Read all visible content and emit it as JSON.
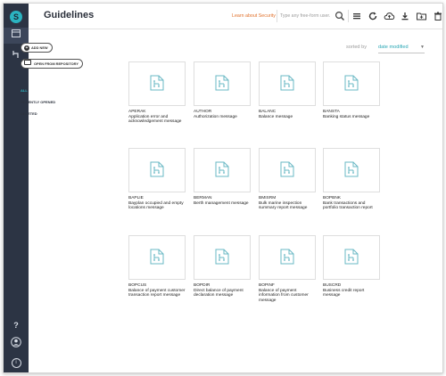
{
  "app": {
    "logo_letter": "S"
  },
  "header": {
    "title": "Guidelines",
    "learn_link": "Learn about Security",
    "search_placeholder": "Type any free-form user..."
  },
  "actions": {
    "add_new": "ADD NEW",
    "open_repo": "OPEN FROM REPOSITORY"
  },
  "filters": [
    {
      "label": "ALL",
      "active": true
    },
    {
      "label": "RECENTLY OPENED",
      "active": false
    },
    {
      "label": "DELETED",
      "active": false
    }
  ],
  "sort": {
    "label": "sorted by",
    "value": "date modified"
  },
  "rail": {
    "help": "?",
    "info": "i"
  },
  "colors": {
    "accent": "#2bb3c0",
    "link_orange": "#e0702a",
    "rail_bg": "#2c3444"
  },
  "cards": [
    {
      "code": "APERAK",
      "desc": "Application error and acknowledgement message"
    },
    {
      "code": "AUTHOR",
      "desc": "Authorization message"
    },
    {
      "code": "BALANC",
      "desc": "Balance message"
    },
    {
      "code": "BANSTA",
      "desc": "Banking status message"
    },
    {
      "code": "BAPLIE",
      "desc": "Bayplan occupied and empty locations message"
    },
    {
      "code": "BERMAN",
      "desc": "Berth management message"
    },
    {
      "code": "BMISRM",
      "desc": "Bulk marine inspection summary report message"
    },
    {
      "code": "BOPBNK",
      "desc": "Bank transactions and portfolio transaction report"
    },
    {
      "code": "BOPCUS",
      "desc": "Balance of payment customer transaction report message"
    },
    {
      "code": "BOPDIR",
      "desc": "Direct balance of payment declaration message"
    },
    {
      "code": "BOPINF",
      "desc": "Balance of payment information from customer message"
    },
    {
      "code": "BUSCRD",
      "desc": "Business credit report message"
    }
  ]
}
